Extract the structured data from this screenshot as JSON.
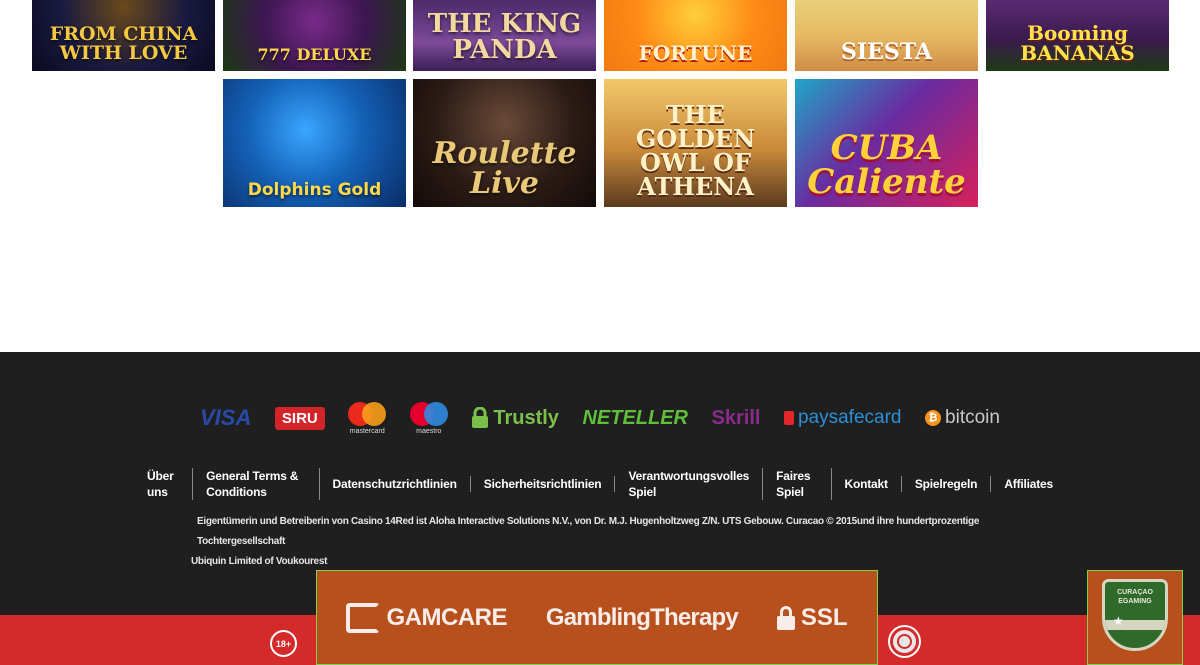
{
  "games": {
    "row1": [
      {
        "title": "FROM CHINA WITH LOVE"
      },
      {
        "title": "777 DELUXE"
      },
      {
        "title": "THE KING PANDA"
      },
      {
        "title": "FORTUNE"
      },
      {
        "title": "SIESTA"
      },
      {
        "title": "Booming BANANAS"
      }
    ],
    "row2": [
      {
        "title": "Dolphins Gold"
      },
      {
        "title": "Roulette Live"
      },
      {
        "title": "THE GOLDEN OWL OF ATHENA"
      },
      {
        "title": "CUBA Caliente"
      }
    ]
  },
  "footer": {
    "payments": {
      "visa": "VISA",
      "siru": "SIRU",
      "mastercard": "mastercard",
      "maestro": "maestro",
      "trustly": "Trustly",
      "neteller": "NETELLER",
      "skrill": "Skrill",
      "paysafecard": "paysafecard",
      "bitcoin": "bitcoin"
    },
    "links": [
      "Über uns",
      "General Terms & Conditions",
      "Datenschutzrichtlinien",
      "Sicherheitsrichtlinien",
      "Verantwortungsvolles Spiel",
      "Faires Spiel",
      "Kontakt",
      "Spielregeln",
      "Affiliates"
    ],
    "legal": {
      "line1": "Eigentümerin und Betreiberin von Casino 14Red ist Aloha Interactive Solutions N.V., von Dr. M.J. Hugenholtzweg Z/N. UTS Gebouw. Curacao © 2015und ihre hundertprozentige Tochtergesellschaft",
      "line2": "Ubiquin Limited of Voukourest"
    },
    "age_badge": "18+",
    "trust": {
      "gamcare": "GAMCARE",
      "gambling_therapy": "GamblingTherapy",
      "ssl": "SSL"
    },
    "curacao": "CURAÇAO EGAMING"
  },
  "colors": {
    "footer_bg": "#1f1f1f",
    "red_bar": "#d42a2a",
    "trust_box": "#b8501e",
    "highlight_border": "#7ed34a"
  }
}
